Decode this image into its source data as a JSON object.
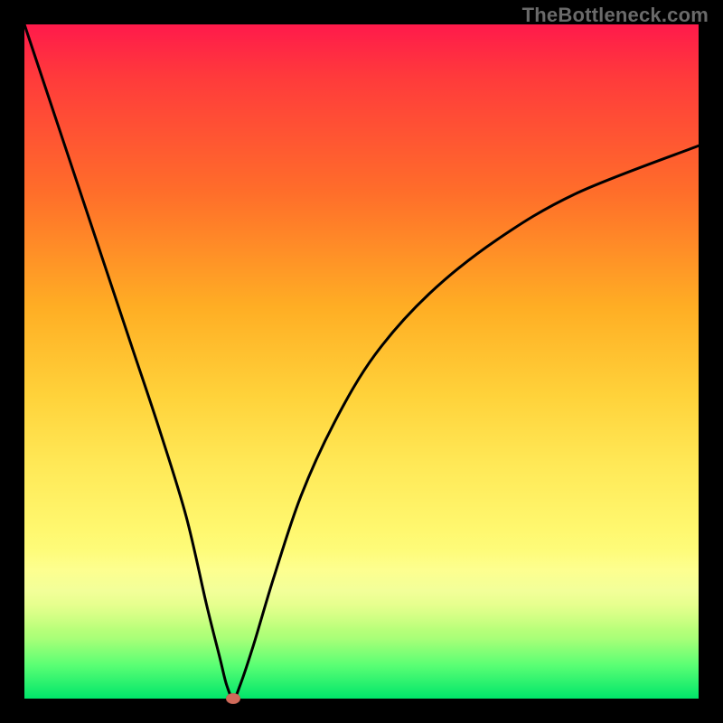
{
  "watermark": "TheBottleneck.com",
  "colors": {
    "frame": "#000000",
    "curve": "#000000",
    "marker": "#d06a5a",
    "gradient_top": "#ff1a4b",
    "gradient_bottom": "#00e56a"
  },
  "chart_data": {
    "type": "line",
    "title": "",
    "xlabel": "",
    "ylabel": "",
    "xlim": [
      0,
      100
    ],
    "ylim": [
      0,
      100
    ],
    "grid": false,
    "legend": false,
    "annotations": [],
    "series": [
      {
        "name": "bottleneck-curve",
        "x": [
          0,
          4,
          8,
          12,
          16,
          20,
          24,
          27,
          29,
          30,
          31,
          32,
          34,
          37,
          41,
          46,
          52,
          60,
          70,
          82,
          100
        ],
        "y": [
          100,
          88,
          76,
          64,
          52,
          40,
          27,
          14,
          6,
          2,
          0,
          2,
          8,
          18,
          30,
          41,
          51,
          60,
          68,
          75,
          82
        ]
      }
    ],
    "marker": {
      "x": 31,
      "y": 0
    }
  }
}
